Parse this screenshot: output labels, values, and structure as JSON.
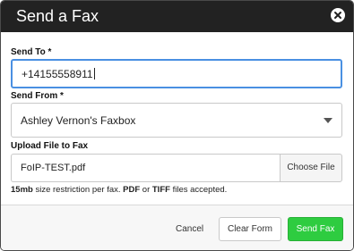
{
  "dialog": {
    "title": "Send a Fax",
    "close_icon": "close-circle-icon"
  },
  "form": {
    "send_to_label": "Send To *",
    "send_to_value": "+14155558911",
    "send_from_label": "Send From *",
    "send_from_value": "Ashley Vernon's Faxbox",
    "upload_label": "Upload File to Fax",
    "file_name": "FoIP-TEST.pdf",
    "choose_file": "Choose File",
    "hint_size": "15mb",
    "hint_text_1": " size restriction per fax. ",
    "hint_pdf": "PDF",
    "hint_or": " or ",
    "hint_tiff": "TIFF",
    "hint_text_2": " files accepted."
  },
  "footer": {
    "cancel": "Cancel",
    "clear": "Clear Form",
    "send": "Send Fax"
  },
  "colors": {
    "header_bg": "#222222",
    "focus_border": "#4a90e2",
    "send_button": "#2ecc40"
  }
}
